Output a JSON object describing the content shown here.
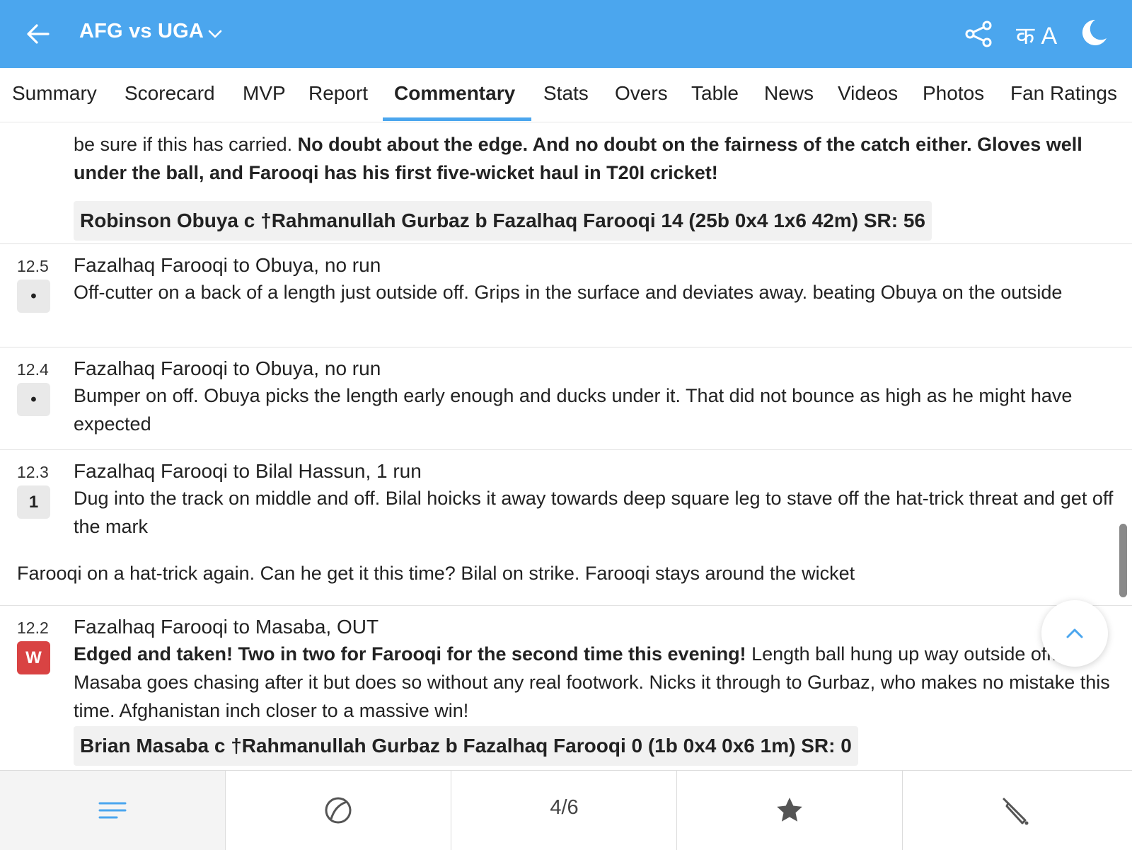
{
  "header": {
    "title": "AFG vs UGA",
    "lang_label": "क A",
    "bg_color": "#4ba6ee"
  },
  "tabs": [
    {
      "label": "Summary"
    },
    {
      "label": "Scorecard"
    },
    {
      "label": "MVP"
    },
    {
      "label": "Report"
    },
    {
      "label": "Commentary",
      "active": true
    },
    {
      "label": "Stats"
    },
    {
      "label": "Overs"
    },
    {
      "label": "Table"
    },
    {
      "label": "News"
    },
    {
      "label": "Videos"
    },
    {
      "label": "Photos"
    },
    {
      "label": "Fan Ratings"
    }
  ],
  "commentary": {
    "top": {
      "partial_line": "be sure if this has carried.",
      "bold_line": "No doubt about the edge. And no doubt on the fairness of the catch either. Gloves well under the ball, and Farooqi has his first five-wicket haul in T20I cricket!",
      "dismissal": "Robinson Obuya c †Rahmanullah Gurbaz b Fazalhaq Farooqi 14 (25b 0x4 1x6 42m) SR: 56"
    },
    "balls": [
      {
        "over": "12.5",
        "result": "•",
        "headline": "Fazalhaq Farooqi to Obuya, no run",
        "text": "Off-cutter on a back of a length just outside off. Grips in the surface and deviates away. beating Obuya on the outside"
      },
      {
        "over": "12.4",
        "result": "•",
        "headline": "Fazalhaq Farooqi to Obuya, no run",
        "text": "Bumper on off. Obuya picks the length early enough and ducks under it. That did not bounce as high as he might have expected"
      },
      {
        "over": "12.3",
        "result": "1",
        "headline": "Fazalhaq Farooqi to Bilal Hassun, 1 run",
        "text": "Dug into the track on middle and off. Bilal hoicks it away towards deep square leg to stave off the hat-trick threat and get off the mark",
        "note": "Farooqi on a hat-trick again. Can he get it this time? Bilal on strike. Farooqi stays around the wicket"
      },
      {
        "over": "12.2",
        "result": "W",
        "headline": "Fazalhaq Farooqi to Masaba, OUT",
        "bold_text": "Edged and taken! Two in two for Farooqi for the second time this evening!",
        "text": "Length ball hung up way outside off. Masaba goes chasing after it but does so without any real footwork. Nicks it through to Gurbaz, who makes no mistake this time. Afghanistan inch closer to a massive win!",
        "dismissal": "Brian Masaba c †Rahmanullah Gurbaz b Fazalhaq Farooqi 0 (1b 0x4 0x6 1m) SR: 0"
      }
    ]
  },
  "bottom_nav": {
    "items": [
      {
        "icon": "list-icon",
        "active": true
      },
      {
        "icon": "ball-icon"
      },
      {
        "label": "4/6"
      },
      {
        "icon": "star-icon"
      },
      {
        "icon": "bat-icon"
      }
    ]
  },
  "colors": {
    "accent": "#4ba6ee",
    "wicket": "#d94343"
  }
}
